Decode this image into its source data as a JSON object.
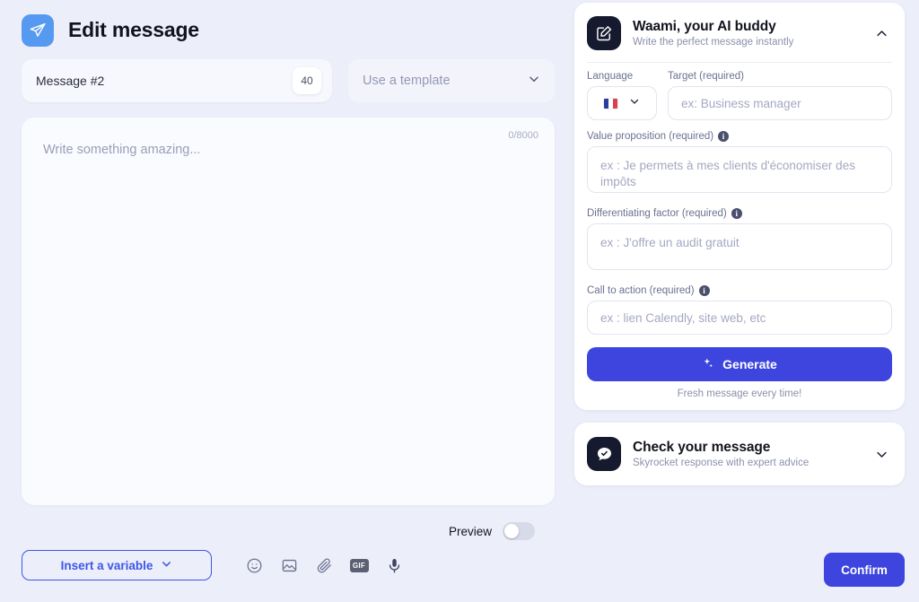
{
  "header": {
    "title": "Edit message",
    "brand_icon": "send-plane-icon",
    "brand_color": "#5599f0"
  },
  "message_row": {
    "name_value": "Message #2",
    "count_badge": "40",
    "template_placeholder": "Use a template",
    "template_chevron": "chevron-down-icon"
  },
  "editor": {
    "placeholder": "Write something amazing...",
    "counter": "0/8000"
  },
  "preview": {
    "label": "Preview",
    "enabled": false
  },
  "toolbar": {
    "insert_variable_label": "Insert a variable",
    "icons": [
      {
        "name": "emoji-icon",
        "label": "emoji"
      },
      {
        "name": "image-icon",
        "label": "image"
      },
      {
        "name": "attachment-icon",
        "label": "attachment"
      },
      {
        "name": "gif-icon",
        "label": "GIF"
      },
      {
        "name": "microphone-icon",
        "label": "voice"
      }
    ]
  },
  "confirm": {
    "label": "Confirm",
    "color": "#3d45de"
  },
  "ai_card": {
    "icon": "edit-square-icon",
    "title": "Waami, your AI buddy",
    "subtitle": "Write the perfect message instantly",
    "chevron": "chevron-up-icon",
    "expanded": true,
    "fields": {
      "language_label": "Language",
      "language_value": "fr",
      "target_label": "Target (required)",
      "target_placeholder": "ex: Business manager",
      "value_prop_label": "Value proposition (required)",
      "value_prop_placeholder": "ex : Je permets à mes clients d'économiser des impôts",
      "differentiating_label": "Differentiating factor (required)",
      "differentiating_placeholder": "ex : J'offre un audit gratuit",
      "cta_label": "Call to action (required)",
      "cta_placeholder": "ex : lien Calendly, site web, etc"
    },
    "generate_label": "Generate",
    "generate_note": "Fresh message every time!"
  },
  "check_card": {
    "icon": "chat-check-icon",
    "title": "Check your message",
    "subtitle": "Skyrocket response with expert advice",
    "chevron": "chevron-down-icon",
    "expanded": false
  }
}
